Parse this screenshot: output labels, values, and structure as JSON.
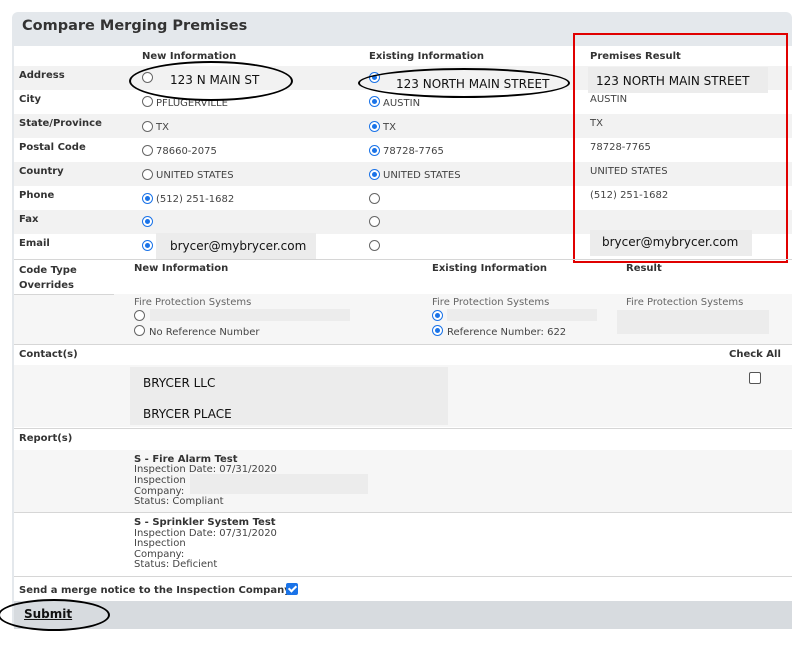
{
  "title": "Compare Merging Premises",
  "columns": {
    "new": "New Information",
    "existing": "Existing Information",
    "result": "Premises Result"
  },
  "rows": [
    {
      "label": "Address",
      "new": "123 N MAIN ST",
      "existing": "123 NORTH MAIN STREET",
      "result": "123 NORTH MAIN STREET",
      "selected": "existing"
    },
    {
      "label": "City",
      "new": "PFLUGERVILLE",
      "existing": "AUSTIN",
      "result": "AUSTIN",
      "selected": "existing"
    },
    {
      "label": "State/Province",
      "new": "TX",
      "existing": "TX",
      "result": "TX",
      "selected": "existing"
    },
    {
      "label": "Postal Code",
      "new": "78660-2075",
      "existing": "78728-7765",
      "result": "78728-7765",
      "selected": "existing"
    },
    {
      "label": "Country",
      "new": "UNITED STATES",
      "existing": "UNITED STATES",
      "result": "UNITED STATES",
      "selected": "existing"
    },
    {
      "label": "Phone",
      "new": "(512) 251-1682",
      "existing": "",
      "result": "(512) 251-1682",
      "selected": "new"
    },
    {
      "label": "Fax",
      "new": "",
      "existing": "",
      "result": "",
      "selected": "new"
    },
    {
      "label": "Email",
      "new": "brycer@mybrycer.com",
      "existing": "",
      "result": "brycer@mybrycer.com",
      "selected": "new"
    }
  ],
  "code_type": {
    "label": "Code Type Overrides",
    "new_header": "New Information",
    "existing_header": "Existing Information",
    "result_header": "Result",
    "new_system": "Fire Protection Systems",
    "existing_system": "Fire Protection Systems",
    "result_system": "Fire Protection Systems",
    "no_reference": "No Reference Number",
    "reference": "Reference Number: 622"
  },
  "contacts": {
    "label": "Contact(s)",
    "check_all": "Check All",
    "items": [
      "BRYCER LLC",
      "BRYCER PLACE"
    ]
  },
  "reports": {
    "label": "Report(s)",
    "items": [
      {
        "title": "S - Fire Alarm Test",
        "date": "Inspection Date: 07/31/2020",
        "line1": "Inspection",
        "line2": "Company:",
        "status": "Status: Compliant"
      },
      {
        "title": "S - Sprinkler System Test",
        "date": "Inspection Date: 07/31/2020",
        "line1": "Inspection",
        "line2": "Company:",
        "status": "Status: Deficient"
      }
    ]
  },
  "merge_notice": "Send a merge notice to the Inspection Company",
  "merge_notice_checked": true,
  "submit": "Submit",
  "colors": {
    "highlight": "#e00000",
    "radio": "#1a73e8",
    "panel": "#e4e8ec"
  }
}
